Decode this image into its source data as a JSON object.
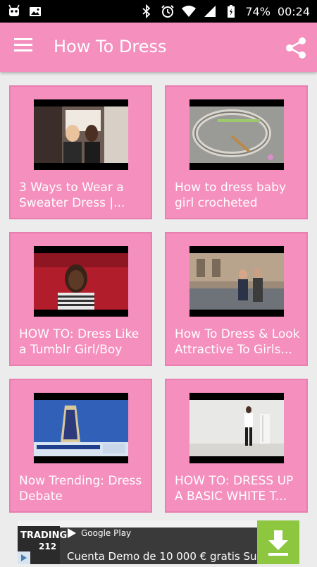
{
  "status_bar": {
    "battery": "74%",
    "time": "00:24"
  },
  "app_bar": {
    "title": "How To Dress"
  },
  "videos": [
    {
      "title": "3 Ways to Wear a Sweater Dress |..."
    },
    {
      "title": "How to dress baby girl crocheted"
    },
    {
      "title": "HOW TO: Dress Like a Tumblr Girl/Boy"
    },
    {
      "title": "How To Dress & Look Attractive To Girls..."
    },
    {
      "title": "Now Trending: Dress Debate"
    },
    {
      "title": "HOW TO: DRESS UP A BASIC WHITE T..."
    }
  ],
  "ad": {
    "brand_line1": "TRADING",
    "brand_line2": "212",
    "store": "Google Play",
    "text": "Cuenta Demo de 10 000 € gratis Su"
  },
  "colors": {
    "primary": "#f48fbe",
    "card_border": "#e97fb0",
    "background": "#ececec",
    "ad_button": "#8dc63f"
  }
}
